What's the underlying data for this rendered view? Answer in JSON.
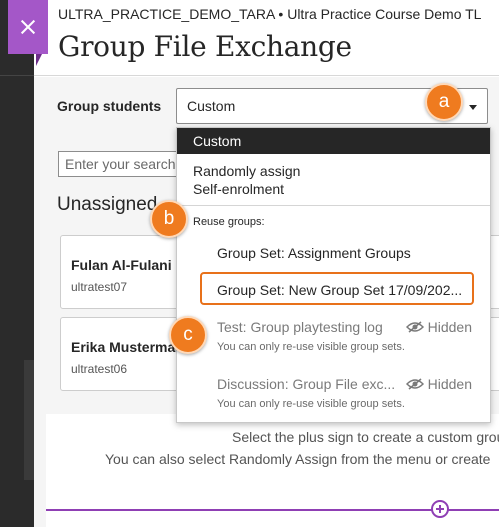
{
  "close": {
    "icon": "close-icon"
  },
  "header": {
    "course_line": "ULTRA_PRACTICE_DEMO_TARA • Ultra Practice Course Demo TL",
    "title": "Group File Exchange"
  },
  "group_students": {
    "label": "Group students",
    "selected": "Custom"
  },
  "search": {
    "placeholder": "Enter your search"
  },
  "unassigned": {
    "title": "Unassigned",
    "students": [
      {
        "name": "Fulan Al-Fulani",
        "id": "ultratest07"
      },
      {
        "name": "Erika Mustermann",
        "id": "ultratest06"
      }
    ]
  },
  "help": {
    "line1": "Select the plus sign to create a custom group.",
    "line2": "You can also select Randomly Assign from the menu or create"
  },
  "dropdown": {
    "options": [
      "Custom",
      "Randomly assign",
      "Self-enrolment"
    ],
    "section_label": "Reuse groups:",
    "group_sets": [
      {
        "label": "Group Set: Assignment Groups"
      },
      {
        "label": "Group Set: New Group Set 17/09/202..."
      },
      {
        "label": "Test: Group playtesting log",
        "status": "Hidden",
        "note": "You can only re-use visible group sets."
      },
      {
        "label": "Discussion: Group File exc...",
        "status": "Hidden",
        "note": "You can only re-use visible group sets."
      }
    ]
  },
  "callouts": [
    "a",
    "b",
    "c"
  ],
  "colors": {
    "accent": "#8f3fb4",
    "close_tab": "#a457c8",
    "callout": "#ef7b1f",
    "highlight": "#e8711a",
    "selected_bg": "#262626"
  }
}
